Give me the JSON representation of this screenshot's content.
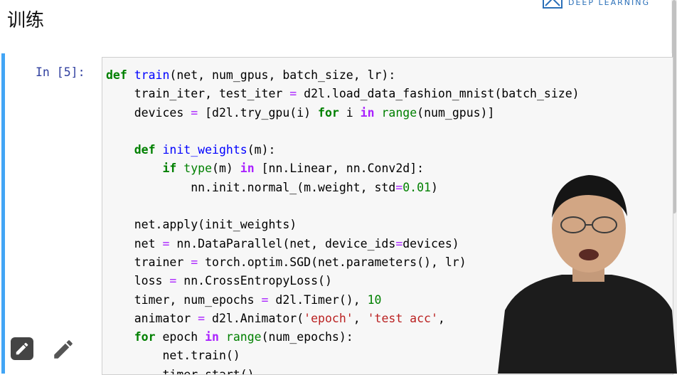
{
  "page": {
    "heading": "训练"
  },
  "logo": {
    "text": "DEEP LEARNING"
  },
  "cell": {
    "prompt": "In [5]:",
    "code_lines": [
      "def train(net, num_gpus, batch_size, lr):",
      "    train_iter, test_iter = d2l.load_data_fashion_mnist(batch_size)",
      "    devices = [d2l.try_gpu(i) for i in range(num_gpus)]",
      "",
      "    def init_weights(m):",
      "        if type(m) in [nn.Linear, nn.Conv2d]:",
      "            nn.init.normal_(m.weight, std=0.01)",
      "",
      "    net.apply(init_weights)",
      "    net = nn.DataParallel(net, device_ids=devices)",
      "    trainer = torch.optim.SGD(net.parameters(), lr)",
      "    loss = nn.CrossEntropyLoss()",
      "    timer, num_epochs = d2l.Timer(), 10",
      "    animator = d2l.Animator('epoch', 'test acc',",
      "    for epoch in range(num_epochs):",
      "        net.train()",
      "        timer.start()"
    ]
  },
  "colors": {
    "cell_border": "#42a5f5",
    "prompt": "#303f9f",
    "keyword": "#008000",
    "operator": "#aa22ff",
    "string": "#ba2121",
    "function_name": "#0000ff",
    "logo": "#2a6fb8"
  },
  "icons": {
    "edit_button": "pencil-icon",
    "edit_plain": "pencil-icon",
    "logo": "logo-mark"
  }
}
